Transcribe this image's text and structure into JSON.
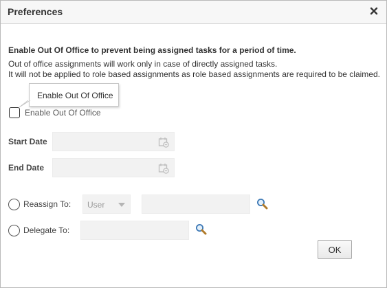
{
  "dialog": {
    "title": "Preferences",
    "close_icon": "close-icon"
  },
  "content": {
    "heading": "Enable Out Of Office to prevent being assigned tasks for a period of time.",
    "note_line1": "Out of office assignments will work only in case of directly assigned tasks.",
    "note_line2": "It will not be applied to role based assignments as role based assignments are required to be claimed."
  },
  "tooltip": {
    "text": "Enable Out Of Office"
  },
  "out_of_office": {
    "checkbox_label": "Enable Out Of Office",
    "checked": false
  },
  "dates": {
    "start_label": "Start Date",
    "start_value": "",
    "end_label": "End Date",
    "end_value": "",
    "icon": "calendar-icon"
  },
  "reassign": {
    "label": "Reassign To:",
    "type_selected": "User",
    "value": "",
    "icon": "search-icon"
  },
  "delegate": {
    "label": "Delegate To:",
    "value": "",
    "icon": "search-icon"
  },
  "buttons": {
    "ok_label": "OK"
  }
}
